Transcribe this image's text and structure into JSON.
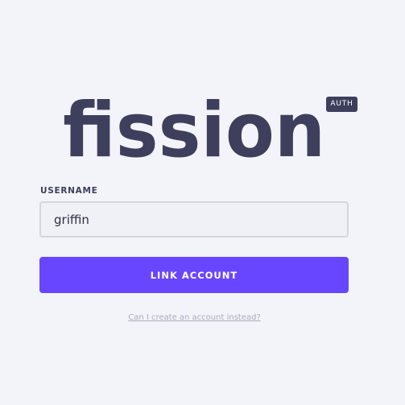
{
  "logo": {
    "text": "fission",
    "badge": "AUTH",
    "color": "#3d3f5c"
  },
  "form": {
    "username_label": "USERNAME",
    "username_value": "griffin",
    "submit_label": "LINK ACCOUNT",
    "alt_link": "Can I create an account instead?"
  },
  "colors": {
    "background": "#f3f4f9",
    "accent": "#6846ff",
    "text_dark": "#3d3f5c",
    "link_muted": "#a9abbd"
  }
}
